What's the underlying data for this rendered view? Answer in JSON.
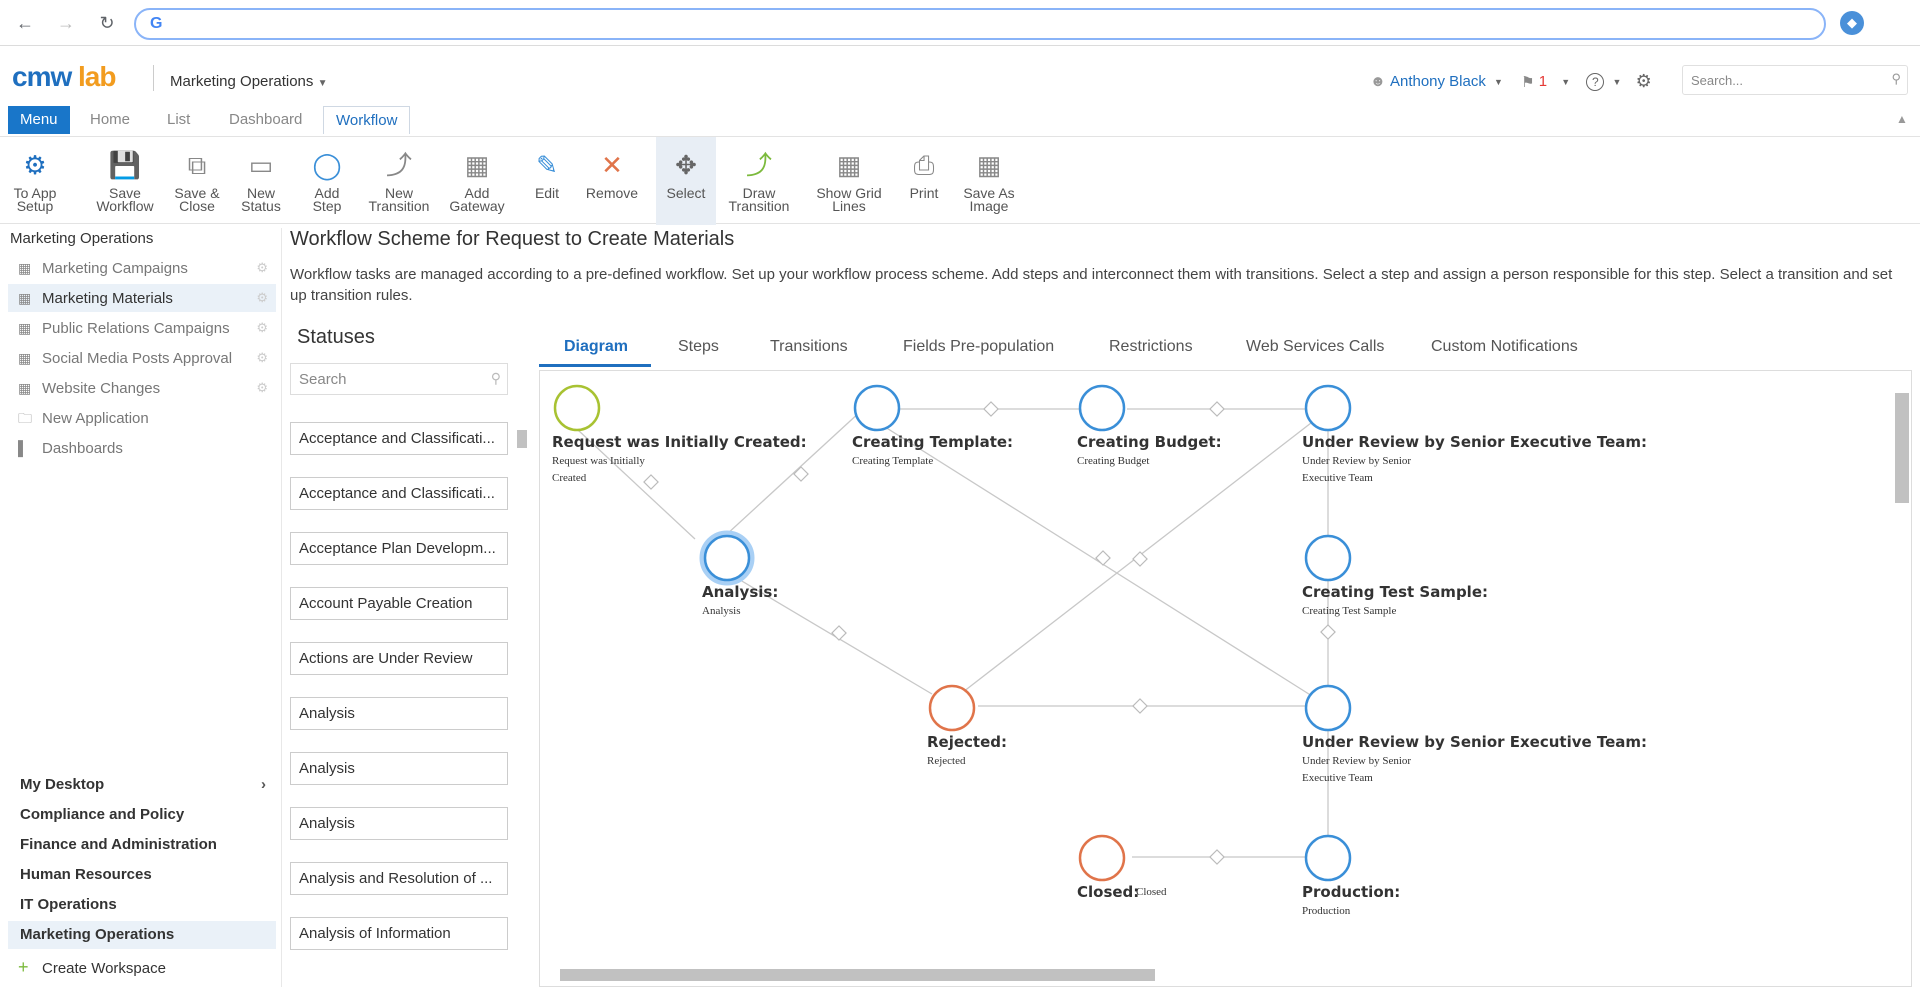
{
  "browser": {
    "address_value": ""
  },
  "header": {
    "logo_cmw": "cmw",
    "logo_lab": "lab",
    "app_title": "Marketing Operations",
    "user_name": "Anthony Black",
    "notifications_count": "1",
    "search_placeholder": "Search..."
  },
  "tabs": [
    "Menu",
    "Home",
    "List",
    "Dashboard",
    "Workflow"
  ],
  "ribbon": [
    {
      "label1": "To App",
      "label2": "Setup",
      "icon": "app-setup-icon"
    },
    {
      "label1": "Save",
      "label2": "Workflow",
      "icon": "save-icon"
    },
    {
      "label1": "Save &",
      "label2": "Close",
      "icon": "save-close-icon"
    },
    {
      "label1": "New",
      "label2": "Status",
      "icon": "new-status-icon"
    },
    {
      "label1": "Add",
      "label2": "Step",
      "icon": "add-step-icon"
    },
    {
      "label1": "New",
      "label2": "Transition",
      "icon": "new-transition-icon"
    },
    {
      "label1": "Add",
      "label2": "Gateway",
      "icon": "add-gateway-icon"
    },
    {
      "label1": "Edit",
      "label2": "",
      "icon": "edit-icon"
    },
    {
      "label1": "Remove",
      "label2": "",
      "icon": "remove-icon"
    },
    {
      "label1": "Select",
      "label2": "",
      "icon": "select-icon"
    },
    {
      "label1": "Draw",
      "label2": "Transition",
      "icon": "draw-transition-icon"
    },
    {
      "label1": "Show Grid",
      "label2": "Lines",
      "icon": "grid-icon"
    },
    {
      "label1": "Print",
      "label2": "",
      "icon": "print-icon"
    },
    {
      "label1": "Save As",
      "label2": "Image",
      "icon": "save-image-icon"
    }
  ],
  "sidebar": {
    "title": "Marketing Operations",
    "items": [
      "Marketing Campaigns",
      "Marketing Materials",
      "Public Relations Campaigns",
      "Social Media Posts Approval",
      "Website Changes",
      "New Application",
      "Dashboards"
    ],
    "groups": [
      "My Desktop",
      "Compliance and Policy",
      "Finance and Administration",
      "Human Resources",
      "IT Operations",
      "Marketing Operations"
    ],
    "create_workspace": "Create Workspace"
  },
  "main": {
    "title": "Workflow Scheme for Request to Create Materials",
    "description": "Workflow tasks are managed according to a pre-defined workflow. Set up your workflow process scheme. Add steps and interconnect them with transitions. Select a step and assign a person responsible for this step. Select a transition and set up transition rules."
  },
  "statuses": {
    "heading": "Statuses",
    "search_placeholder": "Search",
    "items": [
      "Acceptance and Classificati...",
      "Acceptance and Classificati...",
      "Acceptance Plan Developm...",
      "Account Payable Creation",
      "Actions are Under Review",
      "Analysis",
      "Analysis",
      "Analysis",
      "Analysis and Resolution of ...",
      "Analysis of Information"
    ]
  },
  "diagram_tabs": [
    "Diagram",
    "Steps",
    "Transitions",
    "Fields Pre-population",
    "Restrictions",
    "Web Services Calls",
    "Custom Notifications"
  ],
  "diagram": {
    "nodes": {
      "initial": {
        "title": "Request was Initially Created:",
        "sub": "Request was Initially Created"
      },
      "analysis": {
        "title": "Analysis:",
        "sub": "Analysis"
      },
      "creating_template": {
        "title": "Creating Template:",
        "sub": "Creating Template"
      },
      "creating_budget": {
        "title": "Creating Budget:",
        "sub": "Creating Budget"
      },
      "under_review_1": {
        "title": "Under Review by Senior Executive Team:",
        "sub": "Under Review by Senior Executive Team"
      },
      "creating_test_sample": {
        "title": "Creating Test Sample:",
        "sub": "Creating Test Sample"
      },
      "rejected": {
        "title": "Rejected:",
        "sub": "Rejected"
      },
      "under_review_2": {
        "title": "Under Review by Senior Executive Team:",
        "sub": "Under Review by Senior Executive Team"
      },
      "closed": {
        "title": "Closed:",
        "sub": "Closed"
      },
      "production": {
        "title": "Production:",
        "sub": "Production"
      }
    }
  },
  "colors": {
    "accent": "#1f6fbf",
    "node_blue": "#3a8fd8",
    "node_start": "#a8c232",
    "node_end": "#e0744a"
  }
}
